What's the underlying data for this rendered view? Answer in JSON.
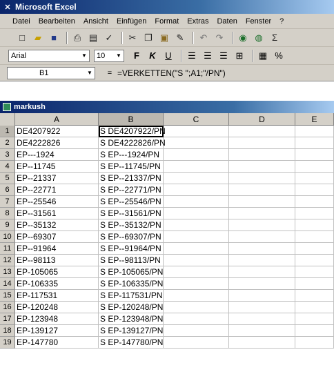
{
  "app": {
    "title": "Microsoft Excel"
  },
  "menu": [
    "Datei",
    "Bearbeiten",
    "Ansicht",
    "Einfügen",
    "Format",
    "Extras",
    "Daten",
    "Fenster",
    "?"
  ],
  "toolbar": {
    "font": "Arial",
    "size": "10",
    "bold": "F",
    "italic": "K",
    "underline": "U",
    "sigma": "Σ",
    "percent": "%"
  },
  "formula_bar": {
    "name_box": "B1",
    "equals": "=",
    "formula": "=VERKETTEN(\"S \";A1;\"/PN\")"
  },
  "workbook": {
    "title": "markush"
  },
  "sheet": {
    "columns": [
      "A",
      "B",
      "C",
      "D",
      "E"
    ],
    "rows": [
      {
        "n": "1",
        "a": "DE4207922",
        "b": "S DE4207922/PN"
      },
      {
        "n": "2",
        "a": "DE4222826",
        "b": "S DE4222826/PN"
      },
      {
        "n": "3",
        "a": "EP---1924",
        "b": "S EP---1924/PN"
      },
      {
        "n": "4",
        "a": "EP--11745",
        "b": "S EP--11745/PN"
      },
      {
        "n": "5",
        "a": "EP--21337",
        "b": "S EP--21337/PN"
      },
      {
        "n": "6",
        "a": "EP--22771",
        "b": "S EP--22771/PN"
      },
      {
        "n": "7",
        "a": "EP--25546",
        "b": "S EP--25546/PN"
      },
      {
        "n": "8",
        "a": "EP--31561",
        "b": "S EP--31561/PN"
      },
      {
        "n": "9",
        "a": "EP--35132",
        "b": "S EP--35132/PN"
      },
      {
        "n": "10",
        "a": "EP--69307",
        "b": "S EP--69307/PN"
      },
      {
        "n": "11",
        "a": "EP--91964",
        "b": "S EP--91964/PN"
      },
      {
        "n": "12",
        "a": "EP--98113",
        "b": "S EP--98113/PN"
      },
      {
        "n": "13",
        "a": "EP-105065",
        "b": "S EP-105065/PN"
      },
      {
        "n": "14",
        "a": "EP-106335",
        "b": "S EP-106335/PN"
      },
      {
        "n": "15",
        "a": "EP-117531",
        "b": "S EP-117531/PN"
      },
      {
        "n": "16",
        "a": "EP-120248",
        "b": "S EP-120248/PN"
      },
      {
        "n": "17",
        "a": "EP-123948",
        "b": "S EP-123948/PN"
      },
      {
        "n": "18",
        "a": "EP-139127",
        "b": "S EP-139127/PN"
      },
      {
        "n": "19",
        "a": "EP-147780",
        "b": "S EP-147780/PN"
      }
    ]
  }
}
